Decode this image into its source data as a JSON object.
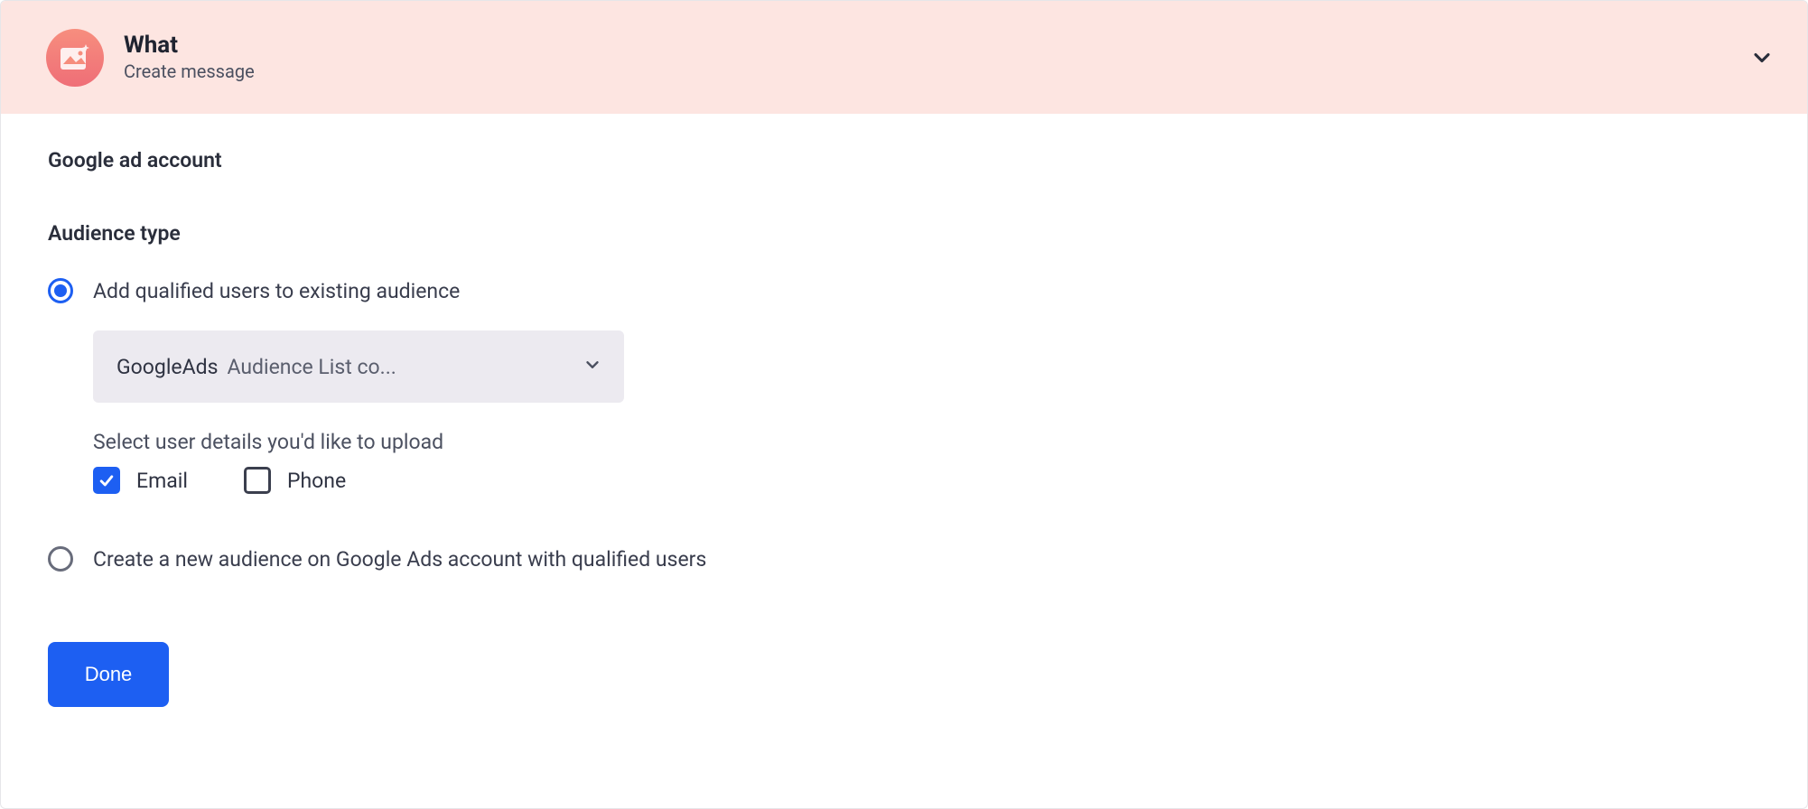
{
  "header": {
    "title": "What",
    "subtitle": "Create message",
    "icon": "image-sparkle-icon"
  },
  "section1_label": "Google ad account",
  "section2_label": "Audience type",
  "option1": {
    "label": "Add qualified users to existing audience",
    "selected": true
  },
  "dropdown": {
    "brand": "GoogleAds",
    "value": "Audience List co..."
  },
  "upload_label": "Select user details you'd like to upload",
  "checks": {
    "email": {
      "label": "Email",
      "checked": true
    },
    "phone": {
      "label": "Phone",
      "checked": false
    }
  },
  "option2": {
    "label": "Create a new audience on Google Ads account with qualified users",
    "selected": false
  },
  "done_label": "Done"
}
